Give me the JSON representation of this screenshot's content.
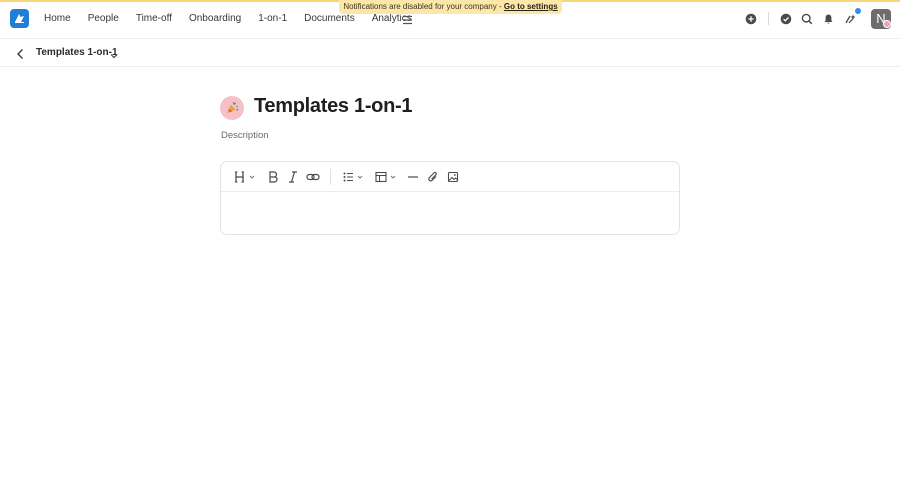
{
  "banner": {
    "message": "Notifications are disabled for your company - ",
    "link": "Go to settings"
  },
  "nav": {
    "items": [
      "Home",
      "People",
      "Time-off",
      "Onboarding",
      "1-on-1",
      "Documents",
      "Analytics"
    ]
  },
  "user": {
    "initial": "N"
  },
  "breadcrumb": {
    "title": "Templates 1-on-1"
  },
  "document": {
    "title": "Templates 1-on-1",
    "description_placeholder": "Description"
  },
  "colors": {
    "brand": "#1f7fd6",
    "banner_bg": "#fbe7a7",
    "notification_dot": "#2f8ee6",
    "emoji_badge_bg": "#f6c1c6"
  },
  "icons": {
    "logo": "app-logo-icon",
    "more": "hamburger-icon",
    "create": "plus-circle-icon",
    "tasks": "check-circle-icon",
    "search": "search-icon",
    "notifications": "bell-icon",
    "updates": "sparkle-icon",
    "back": "chevron-left-icon",
    "breadcrumb_menu": "chevron-down-icon",
    "doc_emoji": "party-popper-icon",
    "heading": "heading-icon",
    "bold": "bold-icon",
    "italic": "italic-icon",
    "link": "link-icon",
    "list": "bullet-list-icon",
    "table": "table-icon",
    "divider": "horizontal-rule-icon",
    "attach": "paperclip-icon",
    "image": "image-icon"
  }
}
